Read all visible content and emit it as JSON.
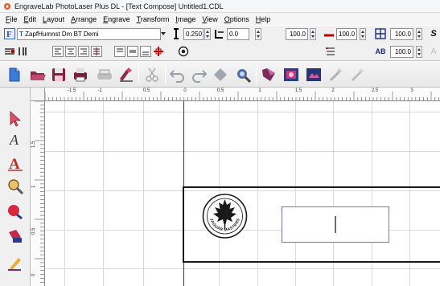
{
  "window": {
    "title": "EngraveLab PhotoLaser Plus DL - [Text Compose] Untitled1.CDL"
  },
  "menu": [
    "File",
    "Edit",
    "Layout",
    "Arrange",
    "Engrave",
    "Transform",
    "Image",
    "View",
    "Options",
    "Help"
  ],
  "property_bar": {
    "font_name": "ZapfHumnst Dm BT Demi",
    "char_height": "0.250",
    "line_spacing": "0.0",
    "char_width_percent": "100.0",
    "char_spacing_percent": "100.0",
    "scale_x": "100.0",
    "scale_y": "100.0",
    "italic_glyph": "S",
    "ab_glyph": "AB",
    "a_glyph": "A"
  },
  "rulers": {
    "horizontal_labels": [
      "-1.5",
      "-1",
      "0.5",
      "0",
      "0.5",
      "1",
      "1.5",
      "2",
      "2.5",
      "3"
    ],
    "vertical_labels": [
      "1.5",
      "1",
      "0.5",
      "0"
    ]
  },
  "logo": {
    "ring_text": "JAGUAR MASTERS"
  },
  "colors": {
    "text_frame_border": "#6f78d0",
    "page_frame": "#1a1a1a",
    "grid": "#d9d9d9"
  },
  "toolbox_icons": [
    "pick-arrow-icon",
    "text-tool-icon",
    "artistic-text-icon",
    "zoom-tool-icon",
    "shape-tool-icon",
    "fill-tool-icon",
    "pen-tool-icon"
  ],
  "toolbar_icons": [
    "new-icon",
    "open-icon",
    "save-icon",
    "print-icon",
    "printer-icon",
    "engrave-icon",
    "cut-icon",
    "undo-icon",
    "redo-icon",
    "node-icon",
    "import-icon",
    "fill-icon",
    "image-icon",
    "photo-icon",
    "effects-icon",
    "wand-icon"
  ]
}
